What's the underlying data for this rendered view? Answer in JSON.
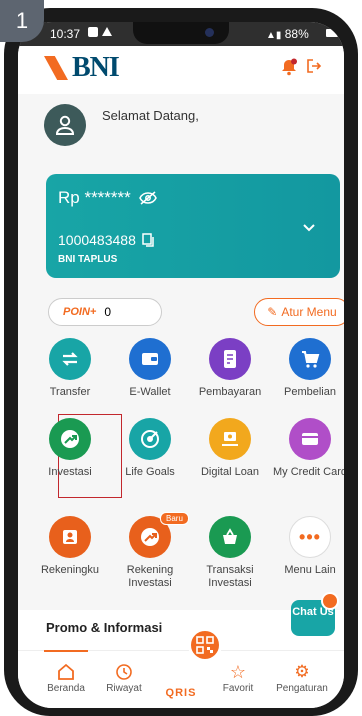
{
  "step": "1",
  "status_bar": {
    "time": "10:37",
    "battery": "88%"
  },
  "header": {
    "logo_text": "BNI",
    "brand_color": "#f26b21",
    "logo_color": "#004a6e"
  },
  "welcome": {
    "greeting": "Selamat Datang,"
  },
  "account_card": {
    "balance": "Rp *******",
    "account_number": "1000483488",
    "account_type": "BNI TAPLUS",
    "color": "#18a5a6"
  },
  "poin": {
    "label": "POIN+",
    "value": "0"
  },
  "atur_menu": {
    "label": "Atur Menu"
  },
  "menu": {
    "transfer": "Transfer",
    "ewallet": "E-Wallet",
    "pembayaran": "Pembayaran",
    "pembelian": "Pembelian",
    "investasi": "Investasi",
    "life_goals": "Life Goals",
    "digital_loan": "Digital Loan",
    "my_credit_card": "My Credit Card",
    "rekeningku": "Rekeningku",
    "rekening_investasi": "Rekening Investasi",
    "transaksi_investasi": "Transaksi Investasi",
    "menu_lain": "Menu Lain",
    "baru_badge": "Baru"
  },
  "promo": {
    "title": "Promo & Informasi"
  },
  "chat": {
    "label": "Chat Us"
  },
  "bottom_nav": {
    "beranda": "Beranda",
    "riwayat": "Riwayat",
    "qris": "QRIS",
    "favorit": "Favorit",
    "pengaturan": "Pengaturan"
  }
}
